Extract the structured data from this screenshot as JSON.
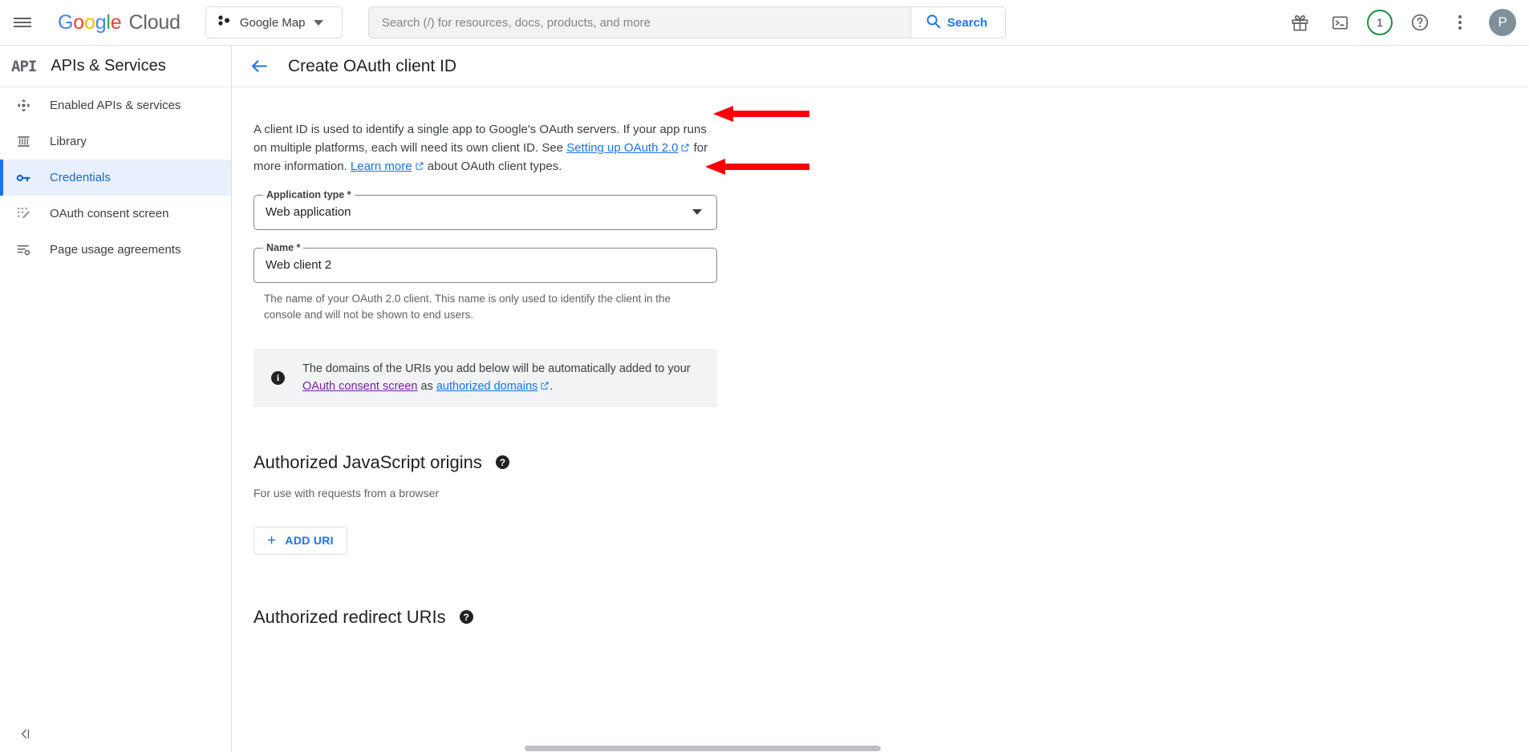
{
  "topbar": {
    "menu_icon": "hamburger-icon",
    "logo": {
      "google": "Google",
      "cloud": "Cloud"
    },
    "project_picker": {
      "label": "Google Map",
      "icon": "project-dots-icon"
    },
    "search": {
      "placeholder": "Search (/) for resources, docs, products, and more",
      "value": "",
      "button_label": "Search",
      "icon": "search-icon"
    },
    "icons": [
      {
        "name": "gift-icon"
      },
      {
        "name": "cloud-shell-icon"
      },
      {
        "name": "notifications-icon",
        "badge": "1",
        "badge_color": "#1e8e3e"
      },
      {
        "name": "help-icon"
      },
      {
        "name": "more-options-icon"
      }
    ],
    "avatar": {
      "initial": "P",
      "color": "#80909a"
    }
  },
  "sidebar": {
    "product_icon": "API",
    "product_title": "APIs & Services",
    "collapse_label": "collapse-panel-icon",
    "items": [
      {
        "label": "Enabled APIs & services",
        "icon": "enabled-apis-icon",
        "active": false
      },
      {
        "label": "Library",
        "icon": "library-icon",
        "active": false
      },
      {
        "label": "Credentials",
        "icon": "key-icon",
        "active": true
      },
      {
        "label": "OAuth consent screen",
        "icon": "consent-screen-icon",
        "active": false
      },
      {
        "label": "Page usage agreements",
        "icon": "page-usage-icon",
        "active": false
      }
    ],
    "active_color": "#1967d2",
    "active_bg": "#e8f0fe"
  },
  "main": {
    "back_icon": "back-arrow-icon",
    "page_title": "Create OAuth client ID",
    "description": {
      "part1": "A client ID is used to identify a single app to Google's OAuth servers. If your app runs on multiple platforms, each will need its own client ID. See ",
      "link1": "Setting up OAuth 2.0",
      "part2": " for more information. ",
      "link2": "Learn more",
      "part3": " about OAuth client types."
    },
    "application_type": {
      "label": "Application type *",
      "value": "Web application",
      "control": "dropdown"
    },
    "name_field": {
      "label": "Name *",
      "value": "Web client 2",
      "helper": "The name of your OAuth 2.0 client. This name is only used to identify the client in the console and will not be shown to end users."
    },
    "info_banner": {
      "icon": "info-icon",
      "part1": "The domains of the URIs you add below will be automatically added to your ",
      "link1": "OAuth consent screen",
      "part2": " as ",
      "link2": "authorized domains",
      "part3": "."
    },
    "js_origins": {
      "title": "Authorized JavaScript origins",
      "help_icon": "help-circle-icon",
      "subtitle": "For use with requests from a browser",
      "add_button": "ADD URI",
      "add_icon": "plus-icon"
    },
    "redirect_uris": {
      "title": "Authorized redirect URIs",
      "help_icon": "help-circle-icon"
    },
    "annotations": [
      {
        "name": "arrow-to-application-type",
        "color": "#fb0007"
      },
      {
        "name": "arrow-to-name-field",
        "color": "#fb0007"
      }
    ]
  }
}
